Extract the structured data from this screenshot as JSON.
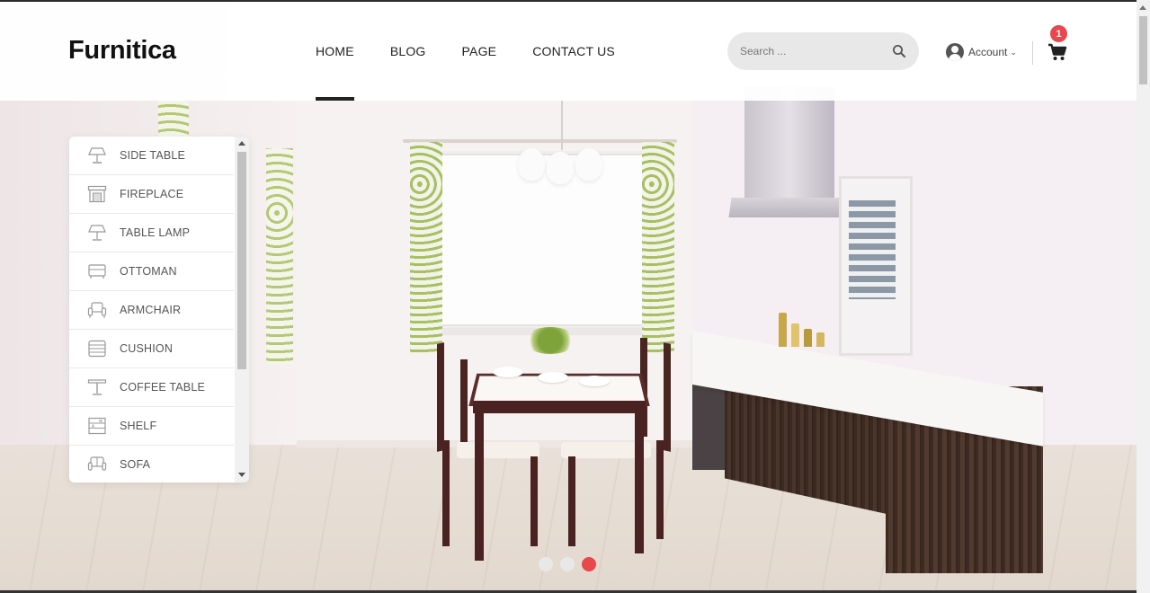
{
  "brand": {
    "logo_text": "Furnitica"
  },
  "nav": {
    "items": [
      {
        "label": "HOME",
        "active": true
      },
      {
        "label": "BLOG",
        "active": false
      },
      {
        "label": "PAGE",
        "active": false
      },
      {
        "label": "CONTACT US",
        "active": false
      }
    ]
  },
  "search": {
    "placeholder": "Search ...",
    "value": "",
    "icon": "search-icon"
  },
  "account": {
    "label": "Account",
    "icon": "user-icon"
  },
  "cart": {
    "count": "1",
    "icon": "cart-icon"
  },
  "categories": [
    {
      "label": "SIDE TABLE",
      "icon": "lamp-icon"
    },
    {
      "label": "FIREPLACE",
      "icon": "fireplace-icon"
    },
    {
      "label": "TABLE LAMP",
      "icon": "lamp-icon"
    },
    {
      "label": "OTTOMAN",
      "icon": "ottoman-icon"
    },
    {
      "label": "ARMCHAIR",
      "icon": "armchair-icon"
    },
    {
      "label": "CUSHION",
      "icon": "cushion-icon"
    },
    {
      "label": "COFFEE TABLE",
      "icon": "coffee-table-icon"
    },
    {
      "label": "SHELF",
      "icon": "shelf-icon"
    },
    {
      "label": "SOFA",
      "icon": "sofa-icon"
    }
  ],
  "slider": {
    "slide_count": 3,
    "active_index": 2
  },
  "colors": {
    "accent": "#e8474b",
    "text_dark": "#222222",
    "header_bg": "#ffffff"
  }
}
